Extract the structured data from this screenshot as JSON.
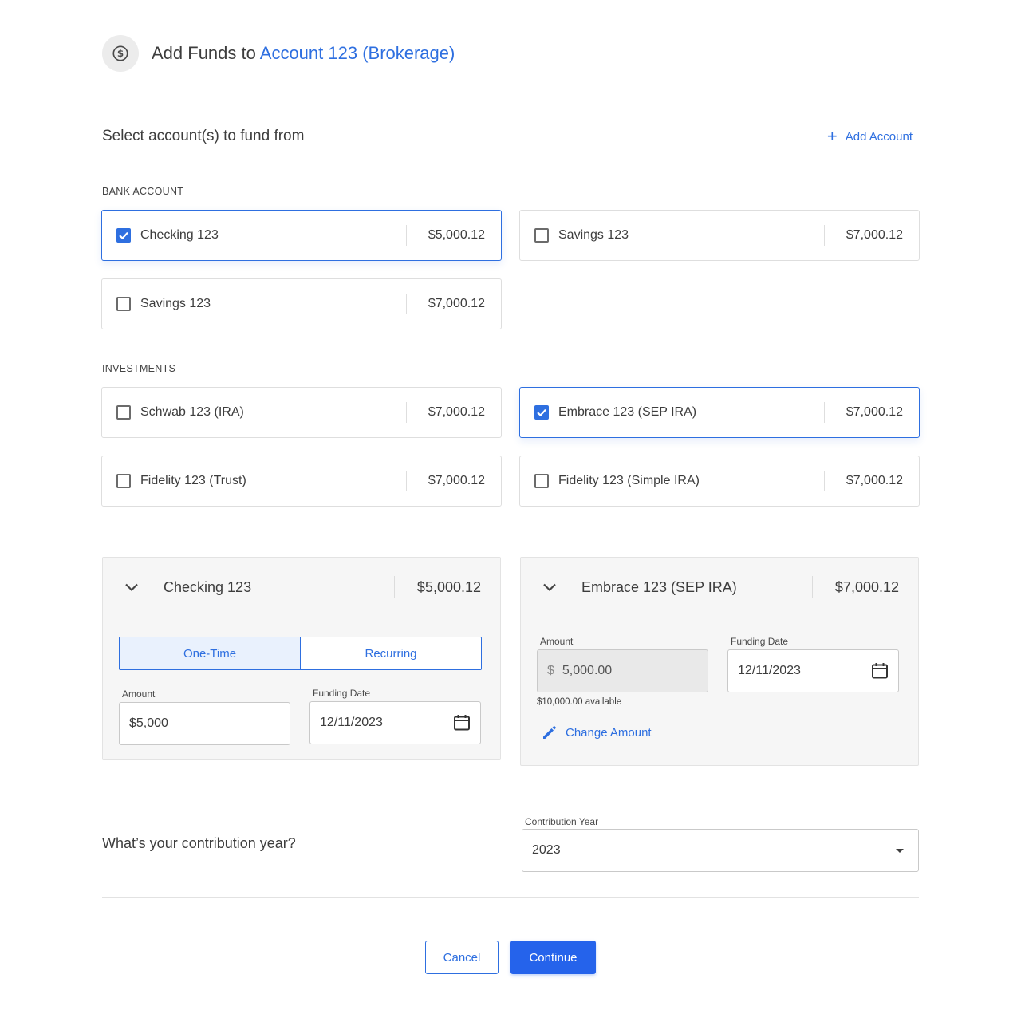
{
  "header": {
    "title_prefix": "Add Funds to ",
    "title_account": "Account 123 (Brokerage)"
  },
  "select_section": {
    "title": "Select account(s) to fund from",
    "add_account_label": "Add Account"
  },
  "bank_group": {
    "label": "BANK ACCOUNT",
    "accounts": [
      {
        "name": "Checking 123",
        "amount": "$5,000.12",
        "checked": true
      },
      {
        "name": "Savings 123",
        "amount": "$7,000.12",
        "checked": false
      },
      {
        "name": "Savings 123",
        "amount": "$7,000.12",
        "checked": false
      }
    ]
  },
  "investments_group": {
    "label": "INVESTMENTS",
    "accounts": [
      {
        "name": "Schwab 123 (IRA)",
        "amount": "$7,000.12",
        "checked": false
      },
      {
        "name": "Embrace 123 (SEP IRA)",
        "amount": "$7,000.12",
        "checked": true
      },
      {
        "name": "Fidelity 123 (Trust)",
        "amount": "$7,000.12",
        "checked": false
      },
      {
        "name": "Fidelity 123 (Simple IRA)",
        "amount": "$7,000.12",
        "checked": false
      }
    ]
  },
  "panel_checking": {
    "name": "Checking 123",
    "amount": "$5,000.12",
    "toggle": {
      "one_time": "One-Time",
      "recurring": "Recurring",
      "active": "one_time"
    },
    "amount_label": "Amount",
    "amount_value": "$5,000",
    "date_label": "Funding Date",
    "date_value": "12/11/2023"
  },
  "panel_embrace": {
    "name": "Embrace 123 (SEP IRA)",
    "amount": "$7,000.12",
    "amount_label": "Amount",
    "amount_prefix": "$",
    "amount_value": "5,000.00",
    "available_text": "$10,000.00 available",
    "date_label": "Funding Date",
    "date_value": "12/11/2023",
    "change_amount_label": "Change Amount"
  },
  "contribution": {
    "question": "What’s your contribution year?",
    "field_label": "Contribution Year",
    "selected_value": "2023"
  },
  "footer": {
    "cancel_label": "Cancel",
    "continue_label": "Continue"
  },
  "colors": {
    "accent": "#2e6fe0",
    "primary_button": "#2563eb",
    "panel_bg": "#f6f6f6"
  }
}
